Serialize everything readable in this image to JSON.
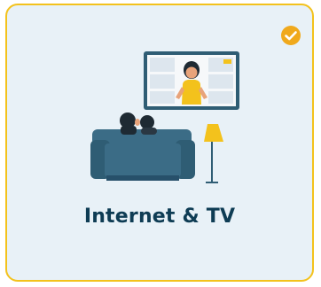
{
  "option_card": {
    "label": "Internet & TV",
    "selected": true,
    "icon": "couch-watching-tv-icon",
    "check_icon": "checkmark-circle-icon",
    "colors": {
      "border": "#f3c21c",
      "background": "#e8f1f7",
      "label": "#0e3c54",
      "check": "#f0a91c"
    }
  }
}
